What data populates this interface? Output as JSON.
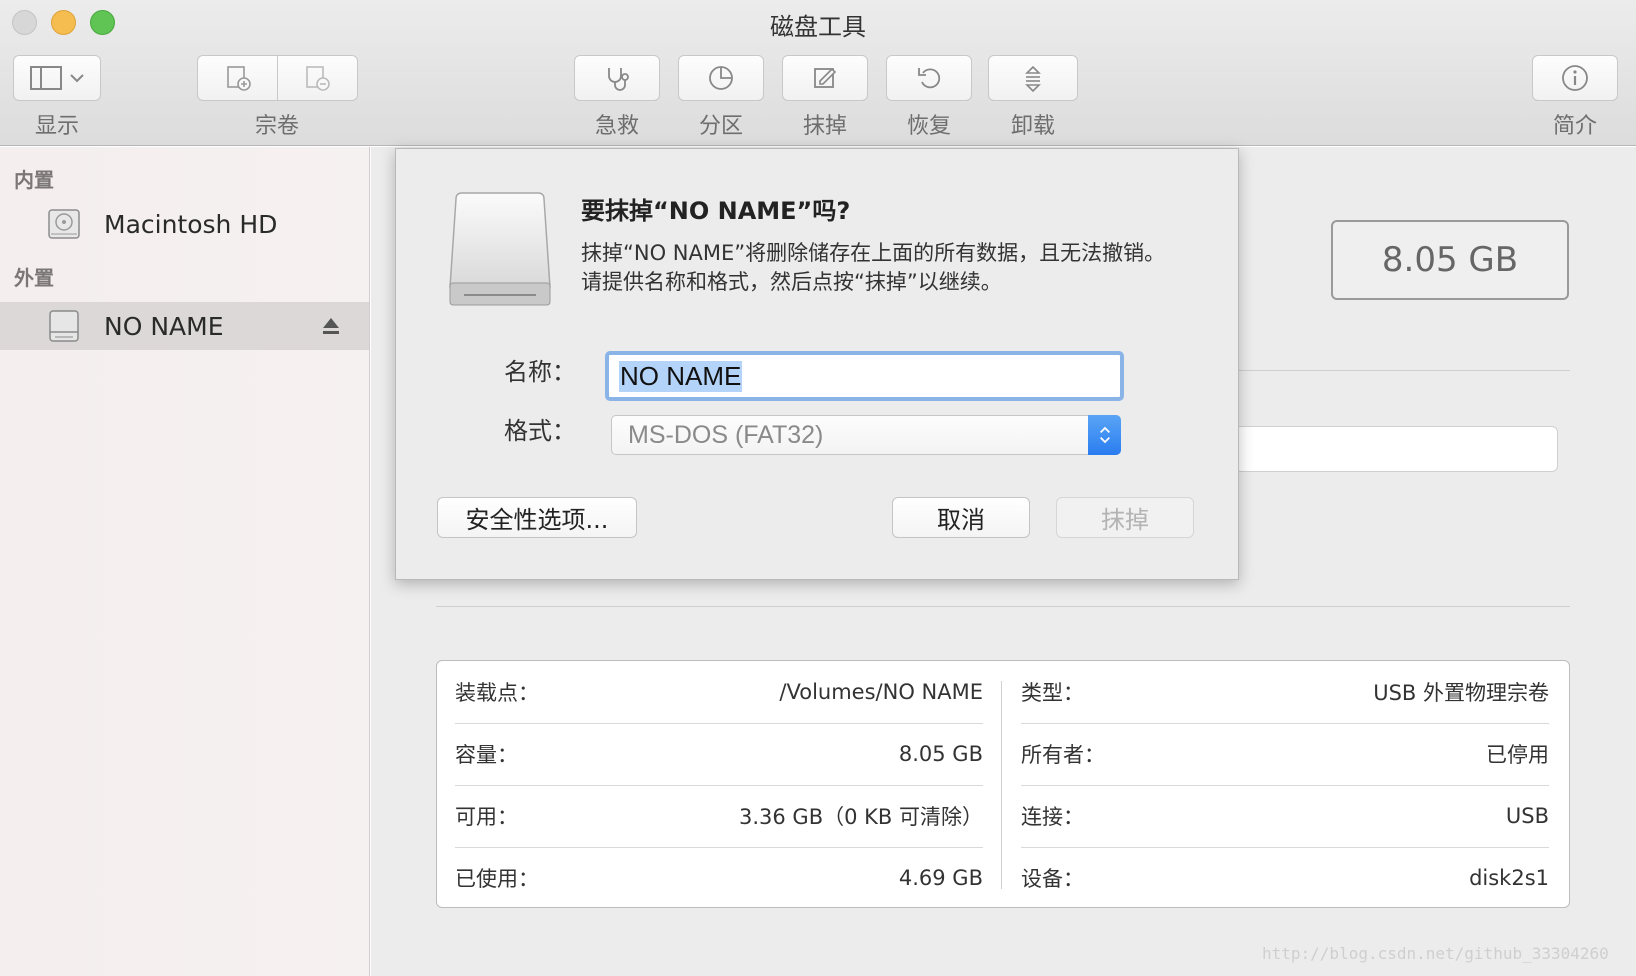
{
  "window": {
    "title": "磁盘工具"
  },
  "toolbar": {
    "view_label": "显示",
    "volume_label": "宗卷",
    "first_aid_label": "急救",
    "partition_label": "分区",
    "erase_label": "抹掉",
    "restore_label": "恢复",
    "unmount_label": "卸载",
    "info_label": "简介"
  },
  "sidebar": {
    "internal_header": "内置",
    "external_header": "外置",
    "internal_items": [
      {
        "label": "Macintosh HD"
      }
    ],
    "external_items": [
      {
        "label": "NO NAME",
        "selected": true
      }
    ]
  },
  "main": {
    "capacity": "8.05 GB",
    "info_left": [
      {
        "key": "装载点：",
        "value": "/Volumes/NO NAME"
      },
      {
        "key": "容量：",
        "value": "8.05 GB"
      },
      {
        "key": "可用：",
        "value": "3.36 GB（0 KB 可清除）"
      },
      {
        "key": "已使用：",
        "value": "4.69 GB"
      }
    ],
    "info_right": [
      {
        "key": "类型：",
        "value": "USB 外置物理宗卷"
      },
      {
        "key": "所有者：",
        "value": "已停用"
      },
      {
        "key": "连接：",
        "value": "USB"
      },
      {
        "key": "设备：",
        "value": "disk2s1"
      }
    ]
  },
  "dialog": {
    "title": "要抹掉“NO NAME”吗?",
    "message": "抹掉“NO NAME”将删除储存在上面的所有数据，且无法撤销。请提供名称和格式，然后点按“抹掉”以继续。",
    "name_label": "名称：",
    "name_value": "NO NAME",
    "format_label": "格式：",
    "format_value": "MS-DOS (FAT32)",
    "security_button": "安全性选项...",
    "cancel_button": "取消",
    "erase_button": "抹掉"
  },
  "watermark": "http://blog.csdn.net/github_33304260",
  "colors": {
    "accent": "#2a7df0",
    "selection": "#b4d3f8",
    "focus_ring": "#8ab4e8"
  }
}
